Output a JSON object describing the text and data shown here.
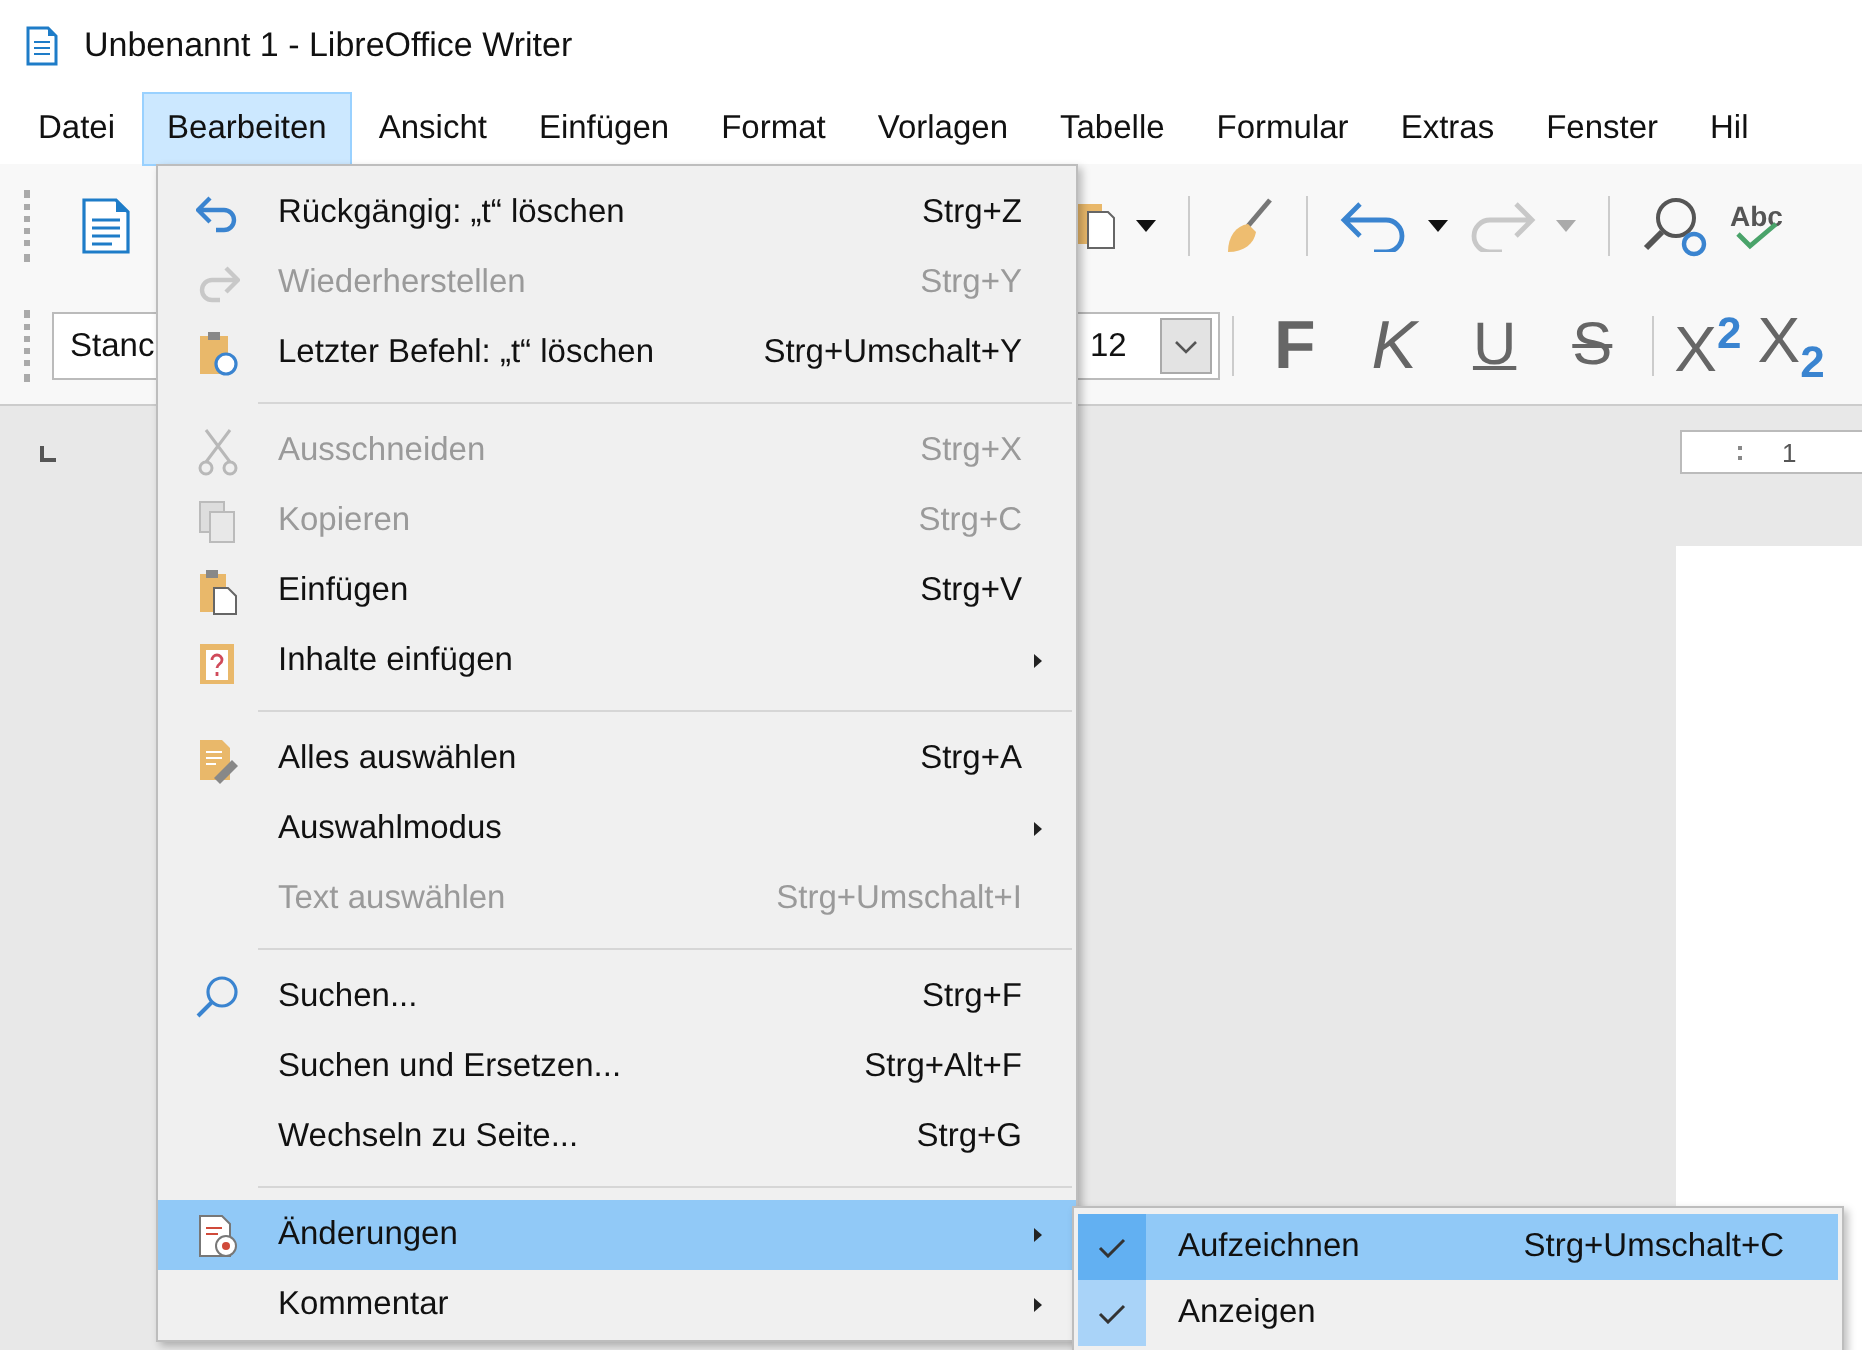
{
  "window": {
    "title": "Unbenannt 1 - LibreOffice Writer"
  },
  "menubar": [
    {
      "label": "Datei",
      "selected": false
    },
    {
      "label": "Bearbeiten",
      "selected": true
    },
    {
      "label": "Ansicht",
      "selected": false
    },
    {
      "label": "Einfügen",
      "selected": false
    },
    {
      "label": "Format",
      "selected": false
    },
    {
      "label": "Vorlagen",
      "selected": false
    },
    {
      "label": "Tabelle",
      "selected": false
    },
    {
      "label": "Formular",
      "selected": false
    },
    {
      "label": "Extras",
      "selected": false
    },
    {
      "label": "Fenster",
      "selected": false
    },
    {
      "label": "Hil",
      "selected": false
    }
  ],
  "toolbar": {
    "spellcheck_label": "Abc"
  },
  "formatting": {
    "paragraph_style": "Stanc",
    "font_size": "12",
    "buttons": [
      {
        "kind": "bold",
        "label": "F"
      },
      {
        "kind": "italic",
        "label": "K"
      },
      {
        "kind": "underline",
        "label": "U"
      },
      {
        "kind": "strike",
        "label": "S"
      },
      {
        "kind": "script",
        "label": "X$^{2}$"
      },
      {
        "kind": "script",
        "label": "X$_{2}$"
      }
    ]
  },
  "ruler": {
    "mark": "1"
  },
  "edit_menu": {
    "items": [
      {
        "kind": "item",
        "label": "Rückgängig: „t“ löschen",
        "shortcut": "Strg+Z",
        "disabled": false,
        "submenu": false,
        "selected": false
      },
      {
        "kind": "item",
        "label": "Wiederherstellen",
        "shortcut": "Strg+Y",
        "disabled": true,
        "submenu": false,
        "selected": false
      },
      {
        "kind": "item",
        "label": "Letzter Befehl: „t“ löschen",
        "shortcut": "Strg+Umschalt+Y",
        "disabled": false,
        "submenu": false,
        "selected": false
      },
      {
        "kind": "separator"
      },
      {
        "kind": "item",
        "label": "Ausschneiden",
        "shortcut": "Strg+X",
        "disabled": true,
        "submenu": false,
        "selected": false
      },
      {
        "kind": "item",
        "label": "Kopieren",
        "shortcut": "Strg+C",
        "disabled": true,
        "submenu": false,
        "selected": false
      },
      {
        "kind": "item",
        "label": "Einfügen",
        "shortcut": "Strg+V",
        "disabled": false,
        "submenu": false,
        "selected": false
      },
      {
        "kind": "item",
        "label": "Inhalte einfügen",
        "disabled": false,
        "submenu": true,
        "selected": false
      },
      {
        "kind": "separator"
      },
      {
        "kind": "item",
        "label": "Alles auswählen",
        "shortcut": "Strg+A",
        "disabled": false,
        "submenu": false,
        "selected": false
      },
      {
        "kind": "item",
        "label": "Auswahlmodus",
        "disabled": false,
        "submenu": true,
        "selected": false
      },
      {
        "kind": "item",
        "label": "Text auswählen",
        "shortcut": "Strg+Umschalt+I",
        "disabled": true,
        "submenu": false,
        "selected": false
      },
      {
        "kind": "separator"
      },
      {
        "kind": "item",
        "label": "Suchen...",
        "shortcut": "Strg+F",
        "disabled": false,
        "submenu": false,
        "selected": false
      },
      {
        "kind": "item",
        "label": "Suchen und Ersetzen...",
        "shortcut": "Strg+Alt+F",
        "disabled": false,
        "submenu": false,
        "selected": false
      },
      {
        "kind": "item",
        "label": "Wechseln zu Seite...",
        "shortcut": "Strg+G",
        "disabled": false,
        "submenu": false,
        "selected": false
      },
      {
        "kind": "separator"
      },
      {
        "kind": "item",
        "label": "Änderungen",
        "disabled": false,
        "submenu": true,
        "selected": true
      },
      {
        "kind": "item",
        "label": "Kommentar",
        "disabled": false,
        "submenu": true,
        "selected": false
      }
    ]
  },
  "changes_submenu": {
    "items": [
      {
        "label": "Aufzeichnen",
        "shortcut": "Strg+Umschalt+C",
        "checked": true,
        "selected": true
      },
      {
        "label": "Anzeigen",
        "checked": true,
        "selected": false
      }
    ]
  }
}
